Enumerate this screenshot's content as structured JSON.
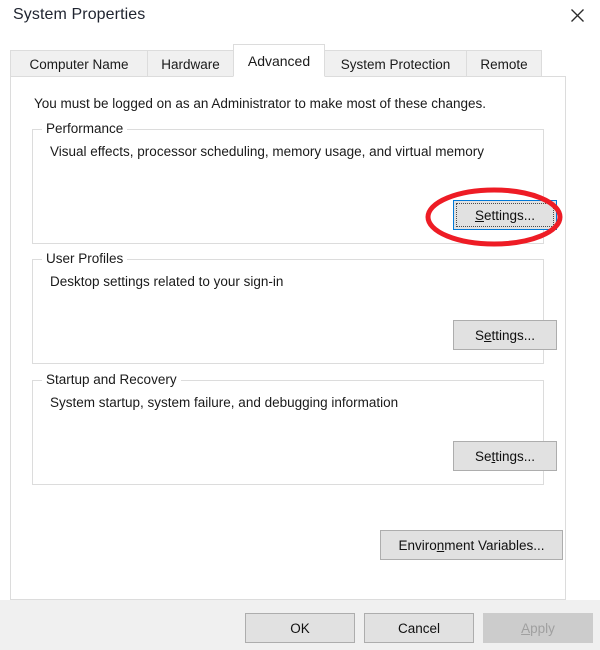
{
  "window": {
    "title": "System Properties",
    "close_icon": "close-icon"
  },
  "tabs": [
    {
      "label": "Computer Name",
      "active": false
    },
    {
      "label": "Hardware",
      "active": false
    },
    {
      "label": "Advanced",
      "active": true
    },
    {
      "label": "System Protection",
      "active": false
    },
    {
      "label": "Remote",
      "active": false
    }
  ],
  "panel": {
    "admin_note": "You must be logged on as an Administrator to make most of these changes."
  },
  "groups": [
    {
      "label": "Performance",
      "description": "Visual effects, processor scheduling, memory usage, and virtual memory",
      "button": {
        "prefix": "",
        "accel": "S",
        "suffix": "ettings...",
        "full_label": "Settings...",
        "focused": true,
        "disabled": false
      }
    },
    {
      "label": "User Profiles",
      "description": "Desktop settings related to your sign-in",
      "button": {
        "prefix": "S",
        "accel": "e",
        "suffix": "ttings...",
        "full_label": "Settings...",
        "focused": false,
        "disabled": false
      }
    },
    {
      "label": "Startup and Recovery",
      "description": "System startup, system failure, and debugging information",
      "button": {
        "prefix": "Se",
        "accel": "t",
        "suffix": "tings...",
        "full_label": "Settings...",
        "focused": false,
        "disabled": false
      }
    }
  ],
  "env_button": {
    "prefix": "Enviro",
    "accel": "n",
    "suffix": "ment Variables...",
    "full_label": "Environment Variables...",
    "disabled": false
  },
  "footer_buttons": [
    {
      "label": "OK",
      "prefix": "OK",
      "accel": "",
      "suffix": "",
      "disabled": false
    },
    {
      "label": "Cancel",
      "prefix": "Cancel",
      "accel": "",
      "suffix": "",
      "disabled": false
    },
    {
      "label": "Apply",
      "prefix": "",
      "accel": "A",
      "suffix": "pply",
      "disabled": true
    }
  ],
  "annotation": {
    "shape": "ellipse",
    "color": "#ee1c25",
    "stroke_width": 5,
    "target": "performance-settings-button"
  }
}
